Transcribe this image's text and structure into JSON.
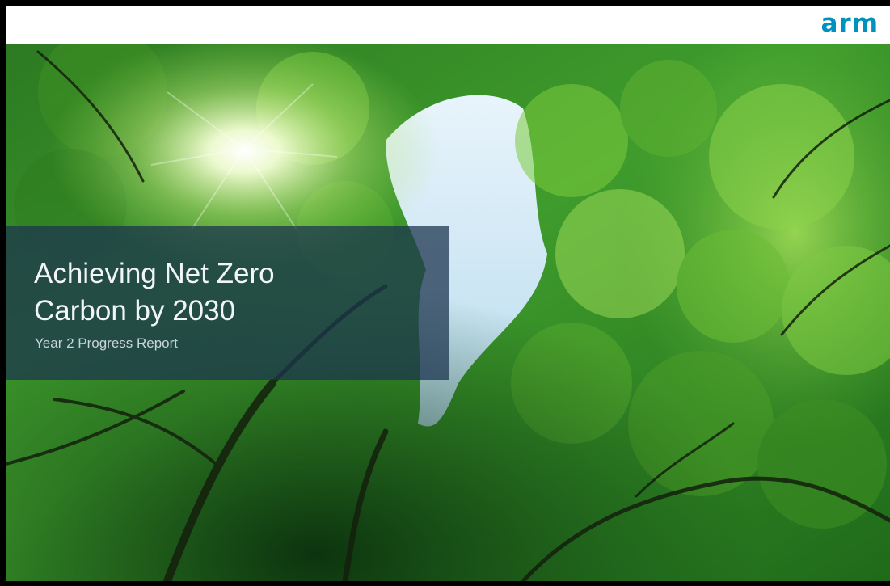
{
  "header": {
    "logo_text": "arm",
    "logo_color": "#0091bd"
  },
  "cover": {
    "title_line1": "Achieving Net Zero",
    "title_line2": "Carbon by 2030",
    "subtitle": "Year 2 Progress Report",
    "image_description_icon": "forest-canopy-photo"
  },
  "colors": {
    "panel": "#1c344e",
    "foliage_dark": "#0d3a12",
    "foliage_mid": "#2f8a25",
    "foliage_light": "#8fd24a",
    "sky": "#cfe6f3"
  }
}
